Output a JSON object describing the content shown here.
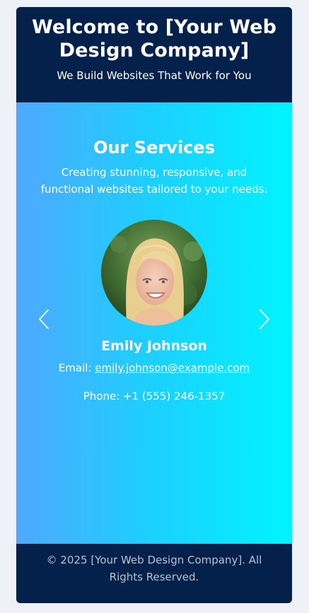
{
  "header": {
    "title": "Welcome to [Your Web Design Company]",
    "tagline": "We Build Websites That Work for You"
  },
  "services": {
    "title": "Our Services",
    "description": "Creating stunning, responsive, and functional websites tailored to your needs."
  },
  "profile": {
    "name": "Emily Johnson",
    "email_label": "Email: ",
    "email": "emily.johnson@example.com",
    "phone": "Phone: +1 (555) 246-1357"
  },
  "footer": {
    "text": "© 2025 [Your Web Design Company]. All Rights Reserved."
  },
  "icons": {
    "prev": "chevron-left-icon",
    "next": "chevron-right-icon"
  },
  "colors": {
    "navy": "#03214a",
    "gradient_start": "#4fa8ff",
    "gradient_end": "#00f4ff",
    "page_background": "#eef1f8"
  }
}
